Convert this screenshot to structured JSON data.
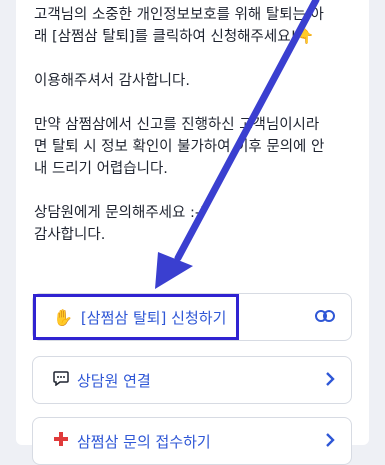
{
  "message": {
    "line1": "고객님의 소중한 개인정보보호를 위해 탈퇴는 아",
    "line2": "래 [삼쩜삼 탈퇴]를 클릭하여 신청해주세요!",
    "line2_emoji": "👇",
    "thanks1": "이용해주셔서 감사합니다.",
    "para2_l1": "만약 삼쩜삼에서 신고를 진행하신 고객님이시라",
    "para2_l2": "면 탈퇴 시 정보 확인이 불가하여 이후 문의에 안",
    "para2_l3": "내 드리기 어렵습니다.",
    "para3_l1": "상담원에게 문의해주세요 :-)",
    "para3_l2": "감사합니다."
  },
  "buttons": [
    {
      "icon": "hand-icon",
      "emoji": "✋",
      "label": "[삼쩜삼 탈퇴] 신청하기",
      "trailing_icon": "link-icon"
    },
    {
      "icon": "chat-icon",
      "label": "상담원 연결",
      "trailing_icon": "chevron-right-icon"
    },
    {
      "icon": "cross-icon",
      "label": "삼쩜삼 문의 접수하기",
      "trailing_icon": "chevron-right-icon"
    }
  ],
  "colors": {
    "accent": "#2f57d6",
    "annotation": "#3023d1",
    "background": "#eef0f5"
  }
}
